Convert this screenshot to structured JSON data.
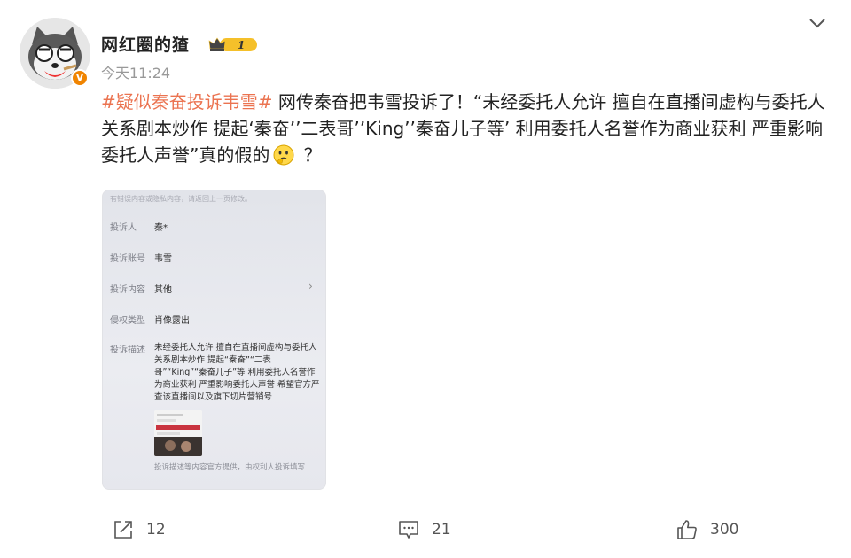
{
  "user": {
    "name": "网红圈的猹",
    "level": "1",
    "verified_badge": "V",
    "avatar_icon": "cartoon-cat-avatar"
  },
  "post": {
    "time": "今天11:24",
    "hashtag": "#疑似秦奋投诉韦雪#",
    "text": " 网传秦奋把韦雪投诉了！“未经委托人允许 擅自在直播间虚构与委托人关系剧本炒作 提起‘秦奋’’二表哥’’King’’秦奋儿子等’ 利用委托人名誉作为商业获利 严重影响委托人声誉”真的假的",
    "emoji": "thinking-face-emoji",
    "text_end": " ？"
  },
  "screenshot": {
    "top_note": "有错误内容或隐私内容，请返回上一页修改。",
    "rows": [
      {
        "label": "投诉人",
        "value": "秦*"
      },
      {
        "label": "投诉账号",
        "value": "韦雪"
      },
      {
        "label": "投诉内容",
        "value": "其他"
      },
      {
        "label": "侵权类型",
        "value": "肖像露出"
      }
    ],
    "arrow": "›",
    "desc_label": "投诉描述",
    "desc_text": "未经委托人允许 擅自在直播间虚构与委托人关系剧本炒作 提起“秦奋”“二表哥”“King”“秦奋儿子”等 利用委托人名誉作为商业获利 严重影响委托人声誉 希望官方严查该直播间以及旗下切片营销号",
    "footer": "投诉描述等内容官方提供，由权利人投诉填写"
  },
  "actions": {
    "repost_count": "12",
    "comment_count": "21",
    "like_count": "300"
  },
  "colors": {
    "hashtag": "#eb7350",
    "badge": "#f08400",
    "level_gold": "#f5c02a"
  }
}
